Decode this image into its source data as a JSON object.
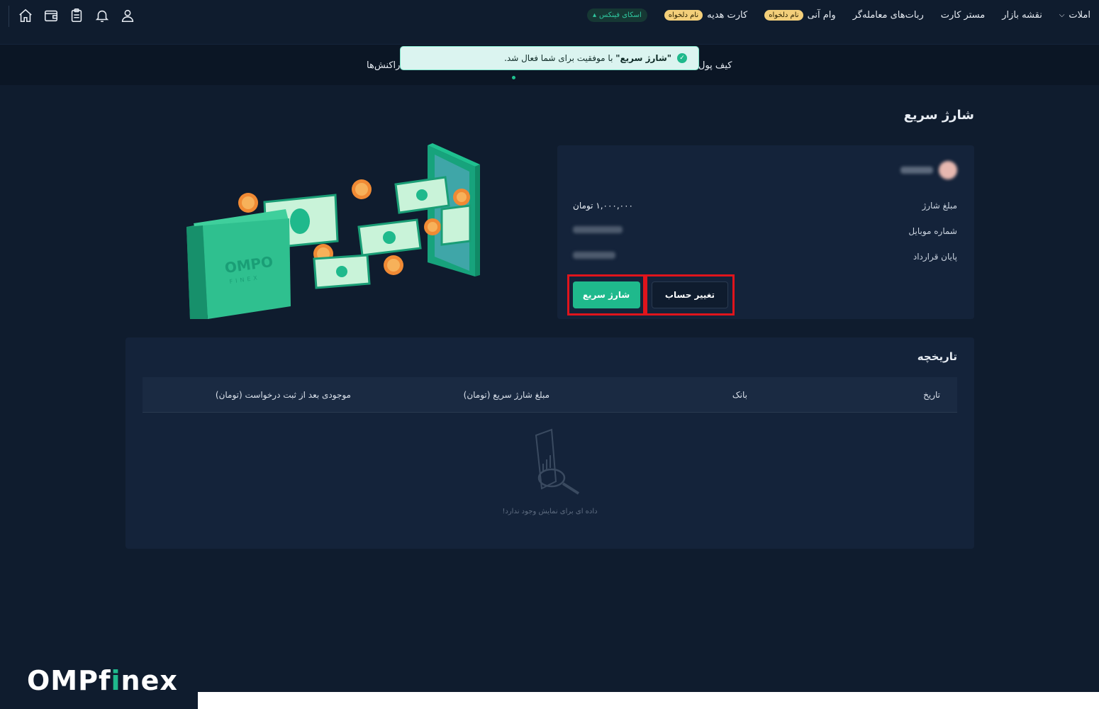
{
  "nav": {
    "items": [
      {
        "label": "املات",
        "dropdown": true
      },
      {
        "label": "نقشه بازار"
      },
      {
        "label": "مستر کارت"
      },
      {
        "label": "ربات‌های معامله‌گر"
      },
      {
        "label": "وام آنی",
        "badge": "نام دلخواه"
      },
      {
        "label": "کارت هدیه",
        "badge": "نام دلخواه"
      }
    ],
    "skyfinex": "اسکای فینکس",
    "icons": [
      "user-icon",
      "bell-icon",
      "clipboard-icon",
      "wallet-icon",
      "home-icon"
    ]
  },
  "subnav": {
    "wallet": "کیف پول",
    "transactions": "راکنش‌ها"
  },
  "toast": {
    "highlight": "\"شارژ سریع\"",
    "message": " با موفقیت برای شما فعال شد."
  },
  "page": {
    "title": "شارژ سریع"
  },
  "info": {
    "amount_label": "مبلغ شارژ",
    "amount_value": "۱,۰۰۰,۰۰۰ تومان",
    "mobile_label": "شماره موبایل",
    "contract_label": "پایان قرارداد",
    "change_account": "تغییر حساب",
    "quick_charge": "شارژ سریع"
  },
  "illustration": {
    "wallet_logo": "OMPO",
    "wallet_sub": "FINEX"
  },
  "history": {
    "title": "تاریخچه",
    "columns": [
      "تاریخ",
      "بانک",
      "مبلغ شارژ سریع (تومان)",
      "موجودی بعد از ثبت درخواست (تومان)"
    ],
    "empty_text": "داده ای برای نمایش وجود ندارد!"
  },
  "brand": {
    "before": "OMPf",
    "accent": "i",
    "after": "nex"
  },
  "colors": {
    "background": "#0f1c2e",
    "card": "#14233a",
    "accent": "#1fb98c",
    "highlight_border": "#e0141c"
  }
}
